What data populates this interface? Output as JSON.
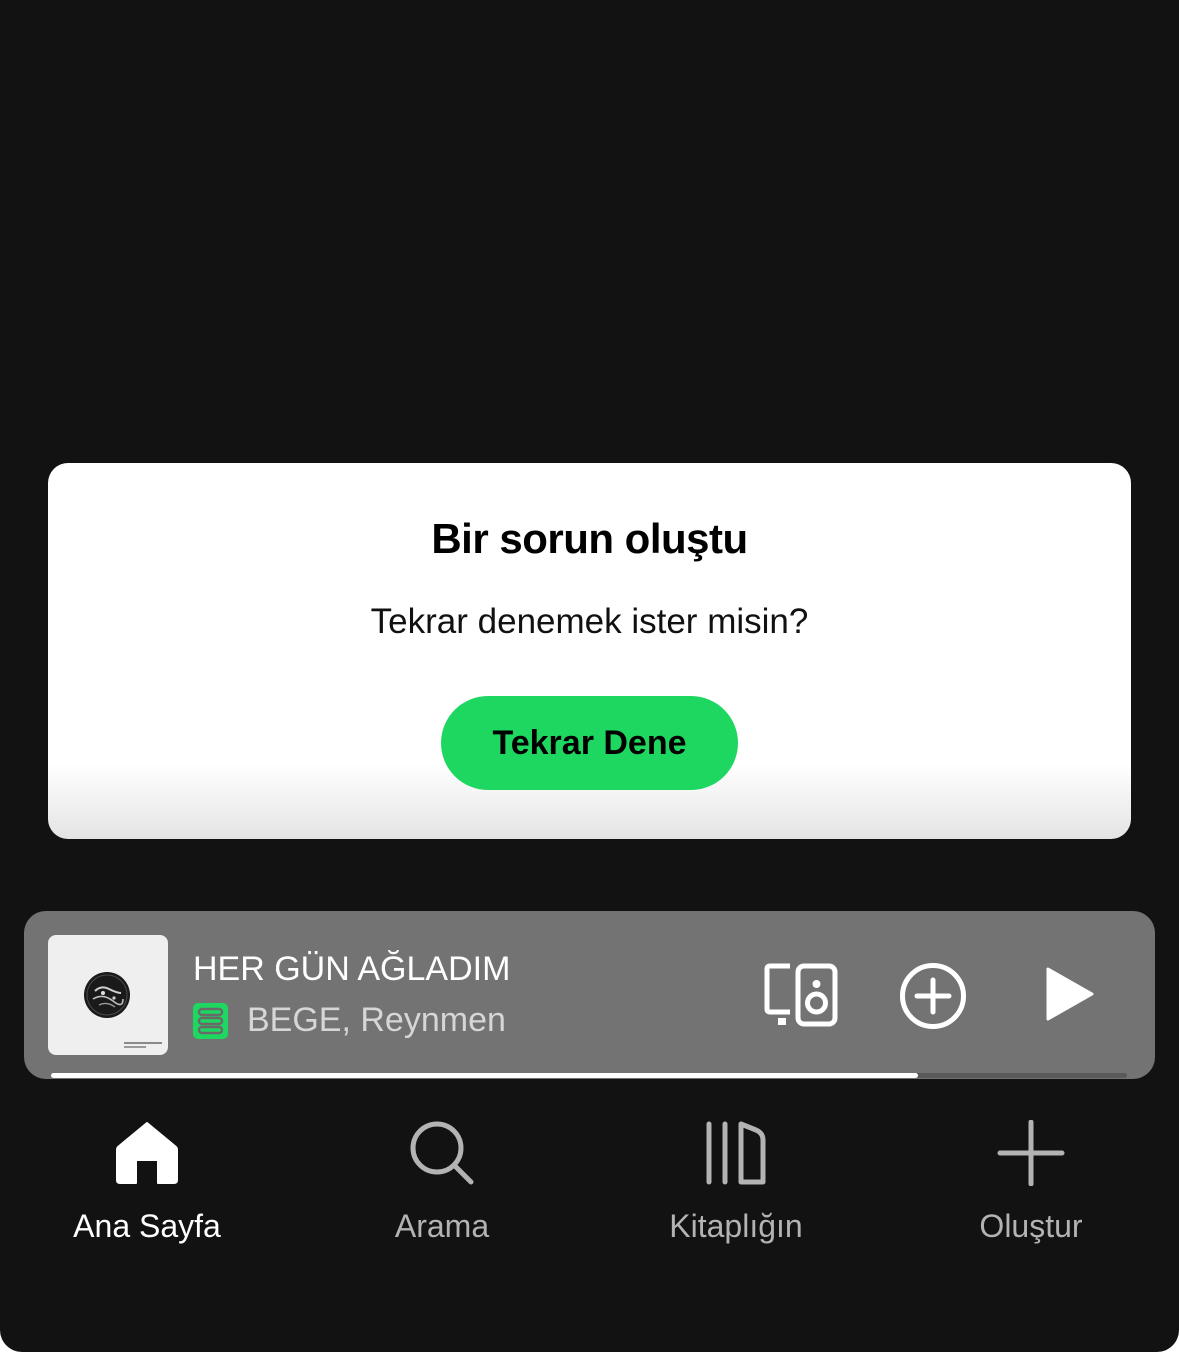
{
  "error_dialog": {
    "title": "Bir sorun oluştu",
    "message": "Tekrar denemek ister misin?",
    "retry_label": "Tekrar Dene"
  },
  "now_playing": {
    "title": "HER GÜN AĞLADIM",
    "artist": "BEGE, Reynmen",
    "downloaded_icon": "downloaded-icon",
    "progress": 0.806,
    "controls": {
      "devices_icon": "connect-devices-icon",
      "add_icon": "add-circle-icon",
      "play_icon": "play-icon"
    }
  },
  "bottom_nav": {
    "items": [
      {
        "label": "Ana Sayfa",
        "icon": "home-icon",
        "active": true
      },
      {
        "label": "Arama",
        "icon": "search-icon",
        "active": false
      },
      {
        "label": "Kitaplığın",
        "icon": "library-icon",
        "active": false
      },
      {
        "label": "Oluştur",
        "icon": "plus-icon",
        "active": false
      }
    ]
  },
  "colors": {
    "background": "#121212",
    "accent_green": "#1ed760",
    "mini_player": "#737373",
    "nav_inactive": "#b3b3b3"
  }
}
